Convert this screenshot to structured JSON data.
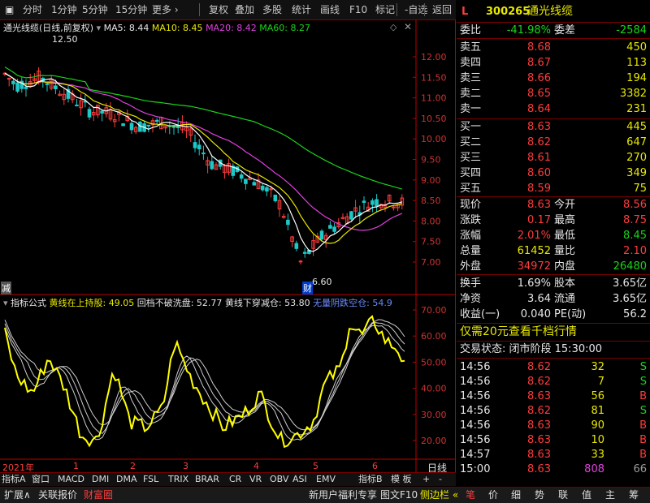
{
  "toolbar": {
    "items": [
      "分时",
      "1分钟",
      "5分钟",
      "15分钟",
      "更多 ›",
      "复权",
      "叠加",
      "多股",
      "统计",
      "画线",
      "F10",
      "标记",
      "-自选",
      "返回"
    ]
  },
  "chart": {
    "title": "通光线缆(日线,前复权)",
    "ma": {
      "ma5": "MA5: 8.44",
      "ma10": "MA10: 8.45",
      "ma20": "MA20: 8.42",
      "ma60": "MA60: 8.27"
    },
    "high_label": "12.50",
    "low_label": "6.60",
    "cai_label": "财",
    "jian_label": "减",
    "price_ticks": [
      "12.00",
      "11.50",
      "11.00",
      "10.50",
      "10.00",
      "9.50",
      "9.00",
      "8.50",
      "8.00",
      "7.50",
      "7.00"
    ],
    "colors": {
      "ma5": "#ffffff",
      "ma10": "#e8e800",
      "ma20": "#e040e0",
      "ma60": "#19d419",
      "up": "#ff3c3c",
      "down": "#1cc8c8"
    }
  },
  "indicator": {
    "name": "指标公式",
    "l1": "黄线在上持股: 49.05",
    "l2": "回档不破洗盘: 52.77",
    "l3": "黄线下穿减仓: 53.80",
    "l4": "无量阴跌空仓: 54.9",
    "ticks": [
      "70.00",
      "60.00",
      "50.00",
      "40.00",
      "30.00",
      "20.00"
    ]
  },
  "xaxis": {
    "year": "2021年",
    "months": [
      "1",
      "2",
      "3",
      "4",
      "5",
      "6"
    ],
    "period": "日线"
  },
  "tabs": {
    "row1": [
      "指标A",
      "窗口",
      "MACD",
      "DMI",
      "DMA",
      "FSL",
      "TRIX",
      "BRAR",
      "CR",
      "VR",
      "OBV",
      "ASI",
      "EMV",
      "指标B",
      "模 板",
      "+",
      "-"
    ],
    "row2": [
      "扩展∧",
      "关联报价",
      "财富圈"
    ],
    "promo1": "新用户福利专享",
    "promo2": "图文F10",
    "promo3": "侧边栏 «"
  },
  "quote": {
    "flag": "L",
    "code": "300265",
    "name": "通光线缆",
    "weibi_label": "委比",
    "weibi": "-41.98%",
    "weicha_label": "委差",
    "weicha": "-2584",
    "asks": [
      {
        "label": "卖五",
        "price": "8.68",
        "vol": "450"
      },
      {
        "label": "卖四",
        "price": "8.67",
        "vol": "113"
      },
      {
        "label": "卖三",
        "price": "8.66",
        "vol": "194"
      },
      {
        "label": "卖二",
        "price": "8.65",
        "vol": "3382"
      },
      {
        "label": "卖一",
        "price": "8.64",
        "vol": "231"
      }
    ],
    "bids": [
      {
        "label": "买一",
        "price": "8.63",
        "vol": "445"
      },
      {
        "label": "买二",
        "price": "8.62",
        "vol": "647"
      },
      {
        "label": "买三",
        "price": "8.61",
        "vol": "270"
      },
      {
        "label": "买四",
        "price": "8.60",
        "vol": "349"
      },
      {
        "label": "买五",
        "price": "8.59",
        "vol": "75"
      }
    ],
    "stats": [
      {
        "l1": "现价",
        "v1": "8.63",
        "l2": "今开",
        "v2": "8.56"
      },
      {
        "l1": "涨跌",
        "v1": "0.17",
        "l2": "最高",
        "v2": "8.75"
      },
      {
        "l1": "涨幅",
        "v1": "2.01%",
        "l2": "最低",
        "v2": "8.45"
      },
      {
        "l1": "总量",
        "v1": "61452",
        "l2": "量比",
        "v2": "2.10"
      },
      {
        "l1": "外盘",
        "v1": "34972",
        "l2": "内盘",
        "v2": "26480"
      }
    ],
    "stats2": [
      {
        "l1": "换手",
        "v1": "1.69%",
        "l2": "股本",
        "v2": "3.65亿"
      },
      {
        "l1": "净资",
        "v1": "3.64",
        "l2": "流通",
        "v2": "3.65亿"
      },
      {
        "l1": "收益(一)",
        "v1": "0.040",
        "l2": "PE(动)",
        "v2": "56.2"
      }
    ],
    "promo": "仅需20元查看千档行情",
    "status": "交易状态: 闭市阶段 15:30:00",
    "ticks": [
      {
        "t": "14:56",
        "p": "8.62",
        "v": "32",
        "d": "S"
      },
      {
        "t": "14:56",
        "p": "8.62",
        "v": "7",
        "d": "S"
      },
      {
        "t": "14:56",
        "p": "8.63",
        "v": "56",
        "d": "B"
      },
      {
        "t": "14:56",
        "p": "8.62",
        "v": "81",
        "d": "S"
      },
      {
        "t": "14:56",
        "p": "8.63",
        "v": "90",
        "d": "B"
      },
      {
        "t": "14:56",
        "p": "8.63",
        "v": "10",
        "d": "B"
      },
      {
        "t": "14:57",
        "p": "8.63",
        "v": "33",
        "d": "B"
      },
      {
        "t": "15:00",
        "p": "8.63",
        "v": "808",
        "d": "66"
      }
    ],
    "tabs": [
      "笔",
      "价",
      "细",
      "势",
      "联",
      "值",
      "主",
      "筹"
    ]
  }
}
